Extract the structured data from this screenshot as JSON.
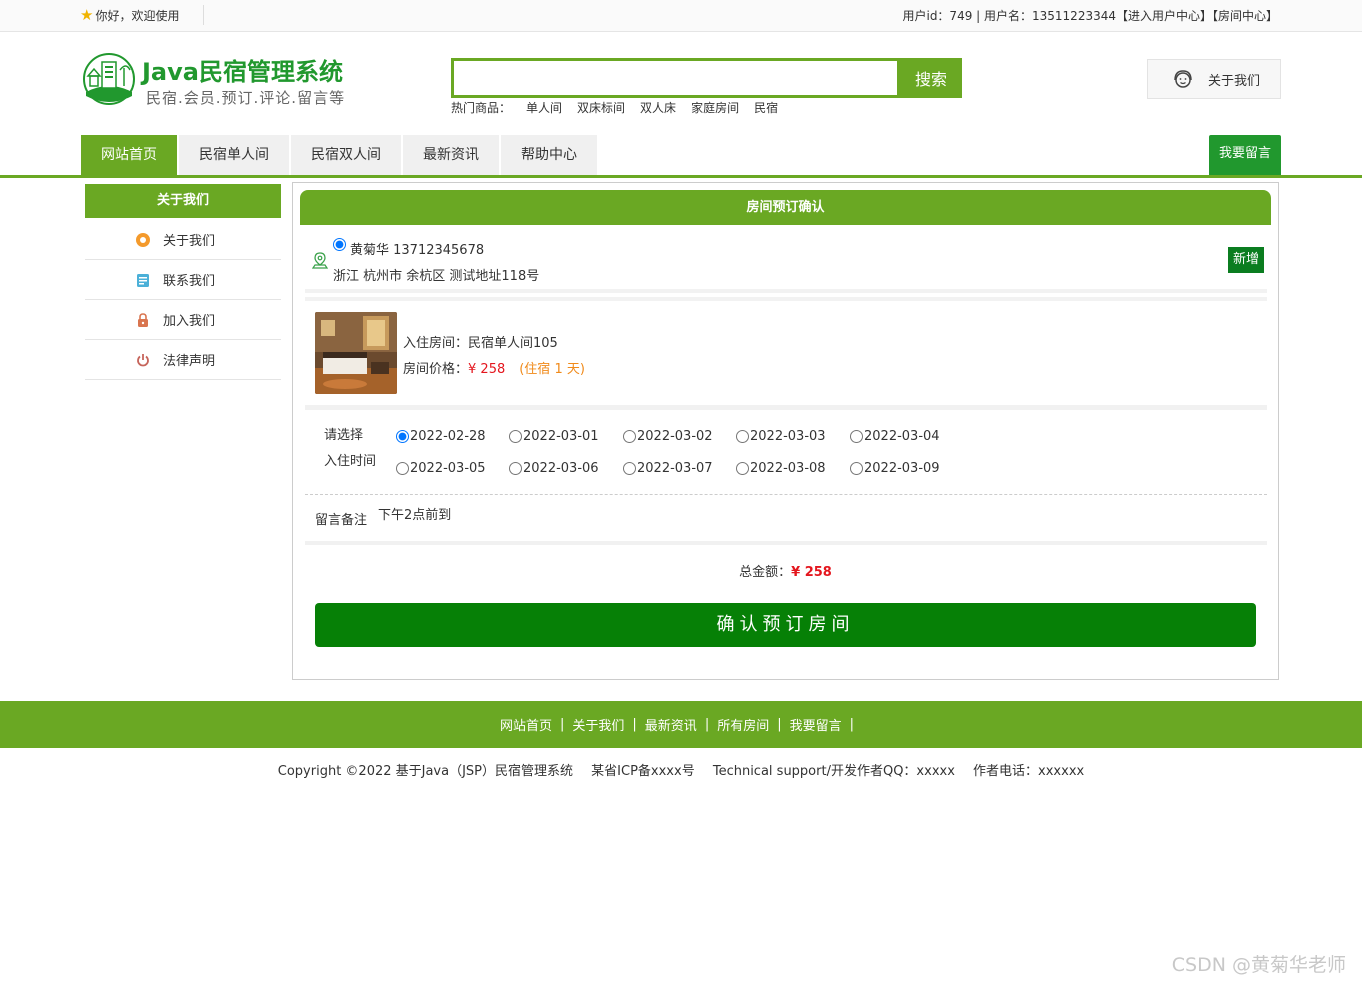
{
  "topbar": {
    "greeting": "你好，欢迎使用",
    "user_info": "用户id：749 | 用户名：13511223344【进入用户中心】【房间中心】"
  },
  "header": {
    "title": "Java民宿管理系统",
    "subtitle": "民宿.会员.预订.评论.留言等",
    "search_placeholder": "",
    "search_button": "搜索",
    "hot_label": "热门商品：",
    "hot_items": [
      "单人间",
      "双床标间",
      "双人床",
      "家庭房间",
      "民宿"
    ],
    "about_label": "关于我们"
  },
  "nav": {
    "tabs": [
      {
        "label": "网站首页",
        "active": true
      },
      {
        "label": "民宿单人间",
        "active": false
      },
      {
        "label": "民宿双人间",
        "active": false
      },
      {
        "label": "最新资讯",
        "active": false
      },
      {
        "label": "帮助中心",
        "active": false
      }
    ],
    "message_button": "我要留言"
  },
  "sidebar": {
    "title": "关于我们",
    "items": [
      {
        "label": "关于我们",
        "icon": "orange-circle-icon"
      },
      {
        "label": "联系我们",
        "icon": "contact-card-icon"
      },
      {
        "label": "加入我们",
        "icon": "lock-icon"
      },
      {
        "label": "法律声明",
        "icon": "power-icon"
      }
    ]
  },
  "booking": {
    "title": "房间预订确认",
    "address_name": "黄菊华 13712345678",
    "address_detail": "浙江 杭州市 余杭区 测试地址118号",
    "add_button": "新增",
    "room_name": "入住房间：民宿单人间105",
    "price_label": "房间价格：",
    "price": "¥ 258",
    "days": "(住宿 1 天)",
    "date_label_1": "请选择",
    "date_label_2": "入住时间",
    "dates": [
      "2022-02-28",
      "2022-03-01",
      "2022-03-02",
      "2022-03-03",
      "2022-03-04",
      "2022-03-05",
      "2022-03-06",
      "2022-03-07",
      "2022-03-08",
      "2022-03-09"
    ],
    "selected_date": "2022-02-28",
    "note_label": "留言备注",
    "note_value": "下午2点前到",
    "total_label": "总金额：",
    "total": "¥ 258",
    "confirm_button": "确认预订房间"
  },
  "footer": {
    "links": [
      "网站首页",
      "关于我们",
      "最新资讯",
      "所有房间",
      "我要留言"
    ],
    "copyright": "Copyright ©2022 基于Java（JSP）民宿管理系统",
    "icp": "某省ICP备xxxx号",
    "support": "Technical support/开发作者QQ：xxxxx",
    "phone": "作者电话：xxxxxx"
  },
  "watermark": "CSDN @黄菊华老师",
  "colors": {
    "primary_green": "#6aa823",
    "dark_green": "#068006",
    "price_red": "#e4161e",
    "days_orange": "#f08a1a"
  }
}
